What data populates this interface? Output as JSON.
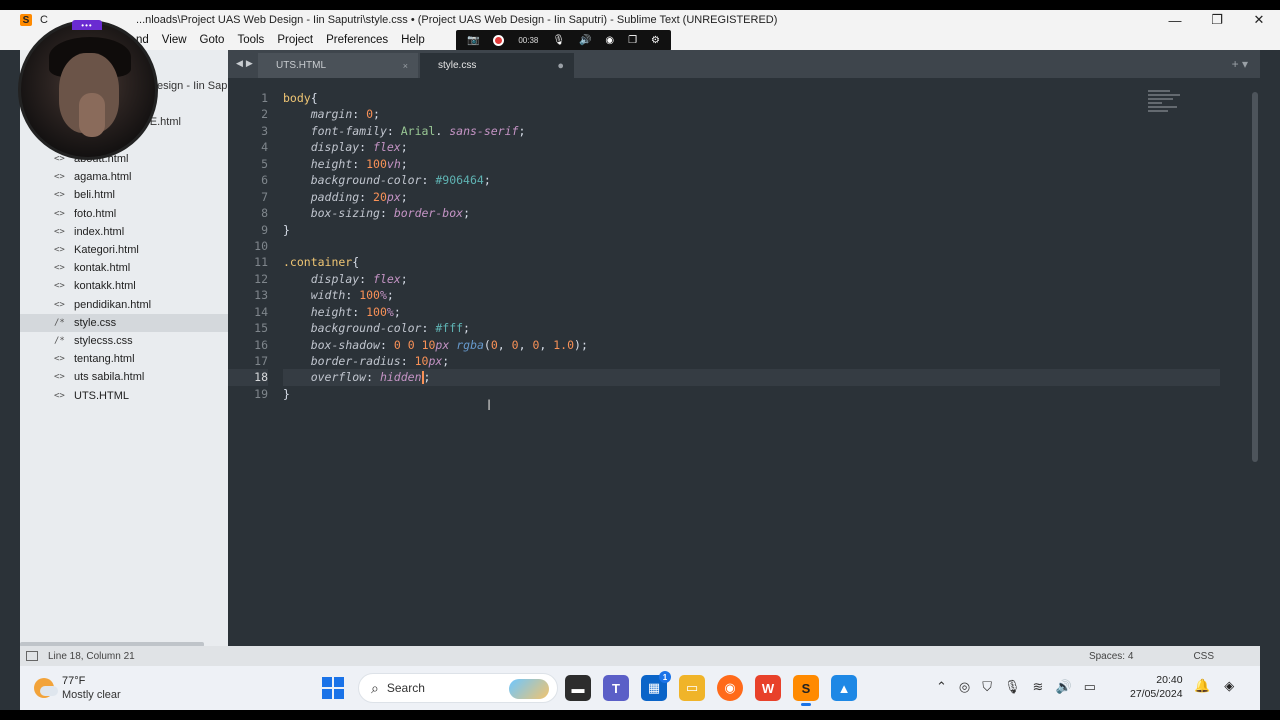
{
  "window": {
    "title_prefix": "C",
    "title": "...nloads\\Project UAS Web Design - Iin Saputri\\style.css • (Project UAS Web Design - Iin Saputri) - Sublime Text (UNREGISTERED)",
    "minimize_icon": "minimize-icon",
    "maximize_icon": "restore-icon",
    "close_icon": "close-icon"
  },
  "menu": {
    "items": [
      "nd",
      "View",
      "Goto",
      "Tools",
      "Project",
      "Preferences",
      "Help"
    ]
  },
  "recorder": {
    "time": "00:38",
    "webcam_label": "•••"
  },
  "sidebar": {
    "project_label": "esign - Iin Sapu",
    "partial_file": "IFE.html",
    "files": [
      {
        "icon": "<>",
        "name": "aboutt.html",
        "active": false
      },
      {
        "icon": "<>",
        "name": "agama.html",
        "active": false
      },
      {
        "icon": "<>",
        "name": "beli.html",
        "active": false
      },
      {
        "icon": "<>",
        "name": "foto.html",
        "active": false
      },
      {
        "icon": "<>",
        "name": "index.html",
        "active": false
      },
      {
        "icon": "<>",
        "name": "Kategori.html",
        "active": false
      },
      {
        "icon": "<>",
        "name": "kontak.html",
        "active": false
      },
      {
        "icon": "<>",
        "name": "kontakk.html",
        "active": false
      },
      {
        "icon": "<>",
        "name": "pendidikan.html",
        "active": false
      },
      {
        "icon": "/*",
        "name": "style.css",
        "active": true
      },
      {
        "icon": "/*",
        "name": "stylecss.css",
        "active": false
      },
      {
        "icon": "<>",
        "name": "tentang.html",
        "active": false
      },
      {
        "icon": "<>",
        "name": "uts sabila.html",
        "active": false
      },
      {
        "icon": "<>",
        "name": "UTS.HTML",
        "active": false
      }
    ]
  },
  "tabs": [
    {
      "label": "UTS.HTML",
      "close": "×",
      "active": false
    },
    {
      "label": "style.css",
      "close": "●",
      "active": true
    }
  ],
  "tabbar_right": "+ ▾",
  "editor": {
    "line_numbers": [
      "1",
      "2",
      "3",
      "4",
      "5",
      "6",
      "7",
      "8",
      "9",
      "10",
      "11",
      "12",
      "13",
      "14",
      "15",
      "16",
      "17",
      "18",
      "19"
    ],
    "current_line": 18
  },
  "status": {
    "position": "Line 18, Column 21",
    "spaces": "Spaces: 4",
    "syntax": "CSS"
  },
  "taskbar": {
    "weather_temp": "77°F",
    "weather_desc": "Mostly clear",
    "search_label": "Search",
    "teams_badge": "1",
    "time": "20:40",
    "date": "27/05/2024"
  },
  "colors": {
    "editor_bg": "#2b3238",
    "selector": "#f0c674",
    "number": "#f99157",
    "string": "#99c794",
    "hex": "#5fb3b3",
    "keyword": "#c594c5"
  }
}
